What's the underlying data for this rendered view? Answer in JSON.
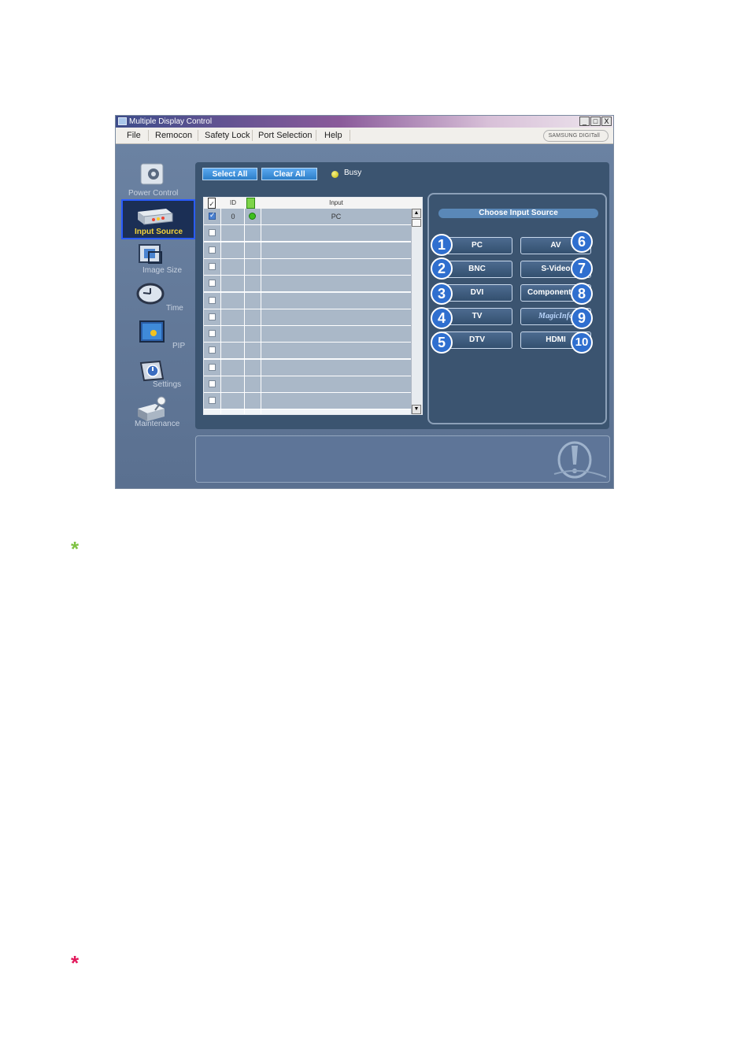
{
  "window": {
    "title": "Multiple Display Control",
    "buttons": {
      "minimize": "_",
      "maximize": "□",
      "close": "X"
    }
  },
  "menu": [
    "File",
    "Remocon",
    "Safety Lock",
    "Port Selection",
    "Help"
  ],
  "brand": "SAMSUNG DIGITall",
  "nav": {
    "items": [
      {
        "label": "Power Control",
        "icon": "power-control-icon"
      },
      {
        "label": "Input Source",
        "icon": "input-source-icon",
        "selected": true
      },
      {
        "label": "Image Size",
        "icon": "image-size-icon"
      },
      {
        "label": "Time",
        "icon": "clock-icon"
      },
      {
        "label": "PIP",
        "icon": "pip-icon"
      },
      {
        "label": "Settings",
        "icon": "settings-icon"
      },
      {
        "label": "Maintenance",
        "icon": "maintenance-icon"
      }
    ]
  },
  "toolbar": {
    "select_all": "Select All",
    "clear_all": "Clear All",
    "busy": "Busy"
  },
  "table": {
    "columns": [
      "ID",
      "Input"
    ],
    "rows": [
      {
        "checked": true,
        "id": "0",
        "status": "on",
        "input": "PC"
      },
      {
        "checked": false,
        "id": "",
        "status": "",
        "input": ""
      },
      {
        "checked": false,
        "id": "",
        "status": "",
        "input": ""
      },
      {
        "checked": false,
        "id": "",
        "status": "",
        "input": ""
      },
      {
        "checked": false,
        "id": "",
        "status": "",
        "input": ""
      },
      {
        "checked": false,
        "id": "",
        "status": "",
        "input": ""
      },
      {
        "checked": false,
        "id": "",
        "status": "",
        "input": ""
      },
      {
        "checked": false,
        "id": "",
        "status": "",
        "input": ""
      },
      {
        "checked": false,
        "id": "",
        "status": "",
        "input": ""
      },
      {
        "checked": false,
        "id": "",
        "status": "",
        "input": ""
      },
      {
        "checked": false,
        "id": "",
        "status": "",
        "input": ""
      },
      {
        "checked": false,
        "id": "",
        "status": "",
        "input": ""
      }
    ]
  },
  "input_source": {
    "heading": "Choose Input Source",
    "left": [
      {
        "num": "1",
        "label": "PC"
      },
      {
        "num": "2",
        "label": "BNC"
      },
      {
        "num": "3",
        "label": "DVI"
      },
      {
        "num": "4",
        "label": "TV"
      },
      {
        "num": "5",
        "label": "DTV"
      }
    ],
    "right": [
      {
        "num": "6",
        "label": "AV"
      },
      {
        "num": "7",
        "label": "S-Video"
      },
      {
        "num": "8",
        "label": "Component"
      },
      {
        "num": "9",
        "label": "MagicInfo"
      },
      {
        "num": "10",
        "label": "HDMI"
      }
    ]
  },
  "colors": {
    "asterisk_green": "#7ec242",
    "asterisk_red": "#e2185b",
    "accent_blue": "#2f6fcf"
  },
  "bullets": [
    "*",
    "*"
  ]
}
